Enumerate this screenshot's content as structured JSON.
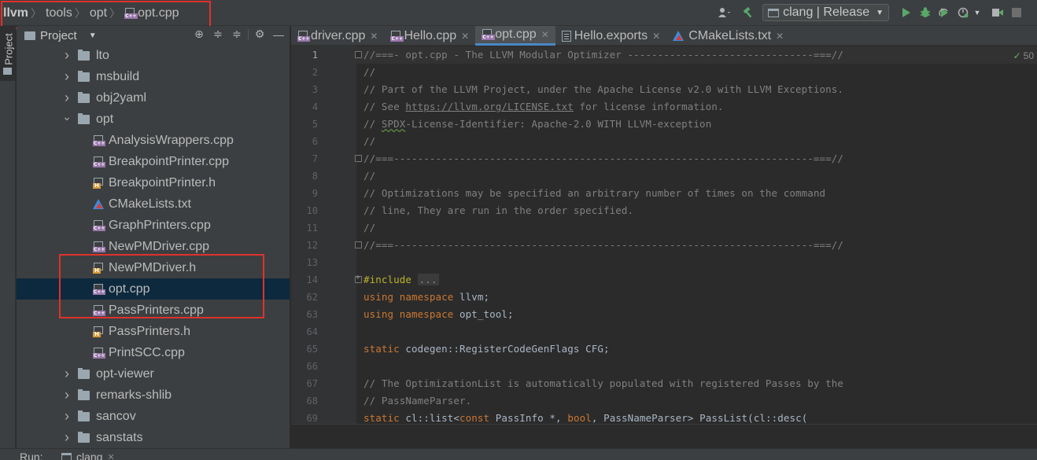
{
  "breadcrumb": [
    {
      "label": "llvm",
      "bold": true
    },
    {
      "label": "tools",
      "bold": false
    },
    {
      "label": "opt",
      "bold": false
    },
    {
      "label": "opt.cpp",
      "bold": false,
      "icon": "cpp-file-icon"
    }
  ],
  "toolbar": {
    "run_config": "clang | Release",
    "icons": [
      "user-icon",
      "build-hammer-icon",
      "run-icon",
      "debug-icon",
      "coverage-icon",
      "profile-icon",
      "attach-icon",
      "stop-icon"
    ]
  },
  "left_strip": {
    "project_tab": "Project"
  },
  "project_panel": {
    "title": "Project",
    "tools": [
      "locate-icon",
      "expand-all-icon",
      "collapse-all-icon",
      "settings-icon",
      "hide-icon"
    ]
  },
  "tree": [
    {
      "label": "lto",
      "type": "folder",
      "level": 1,
      "expanded": false
    },
    {
      "label": "msbuild",
      "type": "folder",
      "level": 1,
      "expanded": false
    },
    {
      "label": "obj2yaml",
      "type": "folder",
      "level": 1,
      "expanded": false
    },
    {
      "label": "opt",
      "type": "folder",
      "level": 1,
      "expanded": true
    },
    {
      "label": "AnalysisWrappers.cpp",
      "type": "cpp",
      "level": 2
    },
    {
      "label": "BreakpointPrinter.cpp",
      "type": "cpp",
      "level": 2
    },
    {
      "label": "BreakpointPrinter.h",
      "type": "h",
      "level": 2
    },
    {
      "label": "CMakeLists.txt",
      "type": "cmake",
      "level": 2
    },
    {
      "label": "GraphPrinters.cpp",
      "type": "cpp",
      "level": 2
    },
    {
      "label": "NewPMDriver.cpp",
      "type": "cpp",
      "level": 2
    },
    {
      "label": "NewPMDriver.h",
      "type": "h",
      "level": 2
    },
    {
      "label": "opt.cpp",
      "type": "cpp",
      "level": 2,
      "selected": true
    },
    {
      "label": "PassPrinters.cpp",
      "type": "cpp",
      "level": 2
    },
    {
      "label": "PassPrinters.h",
      "type": "h",
      "level": 2
    },
    {
      "label": "PrintSCC.cpp",
      "type": "cpp",
      "level": 2
    },
    {
      "label": "opt-viewer",
      "type": "folder",
      "level": 1,
      "expanded": false
    },
    {
      "label": "remarks-shlib",
      "type": "folder",
      "level": 1,
      "expanded": false
    },
    {
      "label": "sancov",
      "type": "folder",
      "level": 1,
      "expanded": false
    },
    {
      "label": "sanstats",
      "type": "folder",
      "level": 1,
      "expanded": false
    }
  ],
  "editor_tabs": [
    {
      "label": "driver.cpp",
      "type": "cpp",
      "active": false
    },
    {
      "label": "Hello.cpp",
      "type": "cpp",
      "active": false
    },
    {
      "label": "opt.cpp",
      "type": "cpp",
      "active": true
    },
    {
      "label": "Hello.exports",
      "type": "txt",
      "active": false
    },
    {
      "label": "CMakeLists.txt",
      "type": "cmake",
      "active": false
    }
  ],
  "inspection_badge": "50",
  "code_lines": [
    {
      "num": "1",
      "current": true,
      "fold": "minus",
      "segments": [
        {
          "c": "comment",
          "t": "//===- opt.cpp - The LLVM Modular Optimizer -------------------------------===//"
        }
      ]
    },
    {
      "num": "2",
      "segments": [
        {
          "c": "comment",
          "t": "//"
        }
      ]
    },
    {
      "num": "3",
      "segments": [
        {
          "c": "comment",
          "t": "// Part of the LLVM Project, under the Apache License v2.0 with LLVM Exceptions."
        }
      ]
    },
    {
      "num": "4",
      "segments": [
        {
          "c": "comment",
          "t": "// See "
        },
        {
          "c": "link",
          "t": "https://llvm.org/LICENSE.txt"
        },
        {
          "c": "comment",
          "t": " for license information."
        }
      ]
    },
    {
      "num": "5",
      "segments": [
        {
          "c": "comment",
          "t": "// "
        },
        {
          "c": "squiggle",
          "t": "SPDX"
        },
        {
          "c": "comment",
          "t": "-License-Identifier: Apache-2.0 WITH LLVM-exception"
        }
      ]
    },
    {
      "num": "6",
      "segments": [
        {
          "c": "comment",
          "t": "//"
        }
      ]
    },
    {
      "num": "7",
      "fold": "minus",
      "segments": [
        {
          "c": "comment",
          "t": "//===----------------------------------------------------------------------===//"
        }
      ]
    },
    {
      "num": "8",
      "segments": [
        {
          "c": "comment",
          "t": "//"
        }
      ]
    },
    {
      "num": "9",
      "segments": [
        {
          "c": "comment",
          "t": "// Optimizations may be specified an arbitrary number of times on the command"
        }
      ]
    },
    {
      "num": "10",
      "segments": [
        {
          "c": "comment",
          "t": "// line, They are run in the order specified."
        }
      ]
    },
    {
      "num": "11",
      "segments": [
        {
          "c": "comment",
          "t": "//"
        }
      ]
    },
    {
      "num": "12",
      "fold": "minus",
      "segments": [
        {
          "c": "comment",
          "t": "//===----------------------------------------------------------------------===//"
        }
      ]
    },
    {
      "num": "13",
      "segments": []
    },
    {
      "num": "14",
      "fold": "plus",
      "segments": [
        {
          "c": "pp",
          "t": "#include"
        },
        {
          "c": "plain",
          "t": " "
        },
        {
          "c": "fold",
          "t": "..."
        }
      ]
    },
    {
      "num": "62",
      "segments": [
        {
          "c": "kw",
          "t": "using namespace"
        },
        {
          "c": "plain",
          "t": " llvm;"
        }
      ]
    },
    {
      "num": "63",
      "segments": [
        {
          "c": "kw",
          "t": "using namespace"
        },
        {
          "c": "plain",
          "t": " opt_tool;"
        }
      ]
    },
    {
      "num": "64",
      "segments": []
    },
    {
      "num": "65",
      "segments": [
        {
          "c": "kw",
          "t": "static"
        },
        {
          "c": "plain",
          "t": " codegen::RegisterCodeGenFlags CFG;"
        }
      ]
    },
    {
      "num": "66",
      "segments": []
    },
    {
      "num": "67",
      "segments": [
        {
          "c": "comment",
          "t": "// The OptimizationList is automatically populated with registered Passes by the"
        }
      ]
    },
    {
      "num": "68",
      "segments": [
        {
          "c": "comment",
          "t": "// PassNameParser."
        }
      ]
    },
    {
      "num": "69",
      "segments": [
        {
          "c": "kw",
          "t": "static"
        },
        {
          "c": "plain",
          "t": " cl::list<"
        },
        {
          "c": "kw",
          "t": "const"
        },
        {
          "c": "plain",
          "t": " PassInfo *, "
        },
        {
          "c": "kw",
          "t": "bool"
        },
        {
          "c": "plain",
          "t": ", PassNameParser> PassList(cl::desc("
        }
      ]
    }
  ],
  "bottom_bar": {
    "run_label": "Run:",
    "run_tab": "clang"
  },
  "colors": {
    "highlight_box": "#e0312d",
    "selection": "#0d293e",
    "accent": "#4a88c7"
  }
}
